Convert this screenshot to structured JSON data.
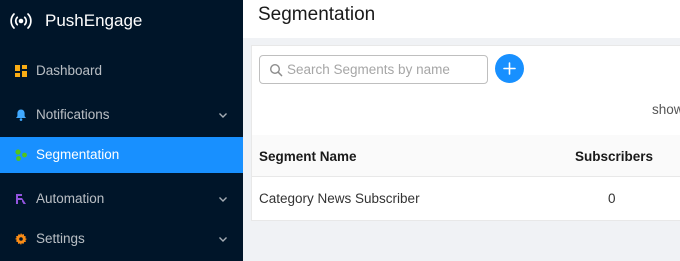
{
  "app": {
    "name": "PushEngage"
  },
  "sidebar": {
    "items": [
      {
        "label": "Dashboard",
        "icon": "dashboard-icon",
        "color": "#faad14"
      },
      {
        "label": "Notifications",
        "icon": "bell-icon",
        "color": "#40a9ff"
      },
      {
        "label": "Segmentation",
        "icon": "segment-icon",
        "color": "#52c41a",
        "active": true
      },
      {
        "label": "Automation",
        "icon": "automation-icon",
        "color": "#9254de"
      },
      {
        "label": "Settings",
        "icon": "gear-icon",
        "color": "#fa8c16"
      }
    ]
  },
  "page": {
    "title": "Segmentation"
  },
  "search": {
    "placeholder": "Search Segments by name",
    "value": ""
  },
  "controls": {
    "show_label": "show"
  },
  "table": {
    "columns": [
      "Segment Name",
      "Subscribers"
    ],
    "rows": [
      {
        "name": "Category News Subscriber",
        "subscribers": "0"
      }
    ]
  },
  "colors": {
    "accent": "#1890ff",
    "sidebar_bg": "#001529"
  }
}
